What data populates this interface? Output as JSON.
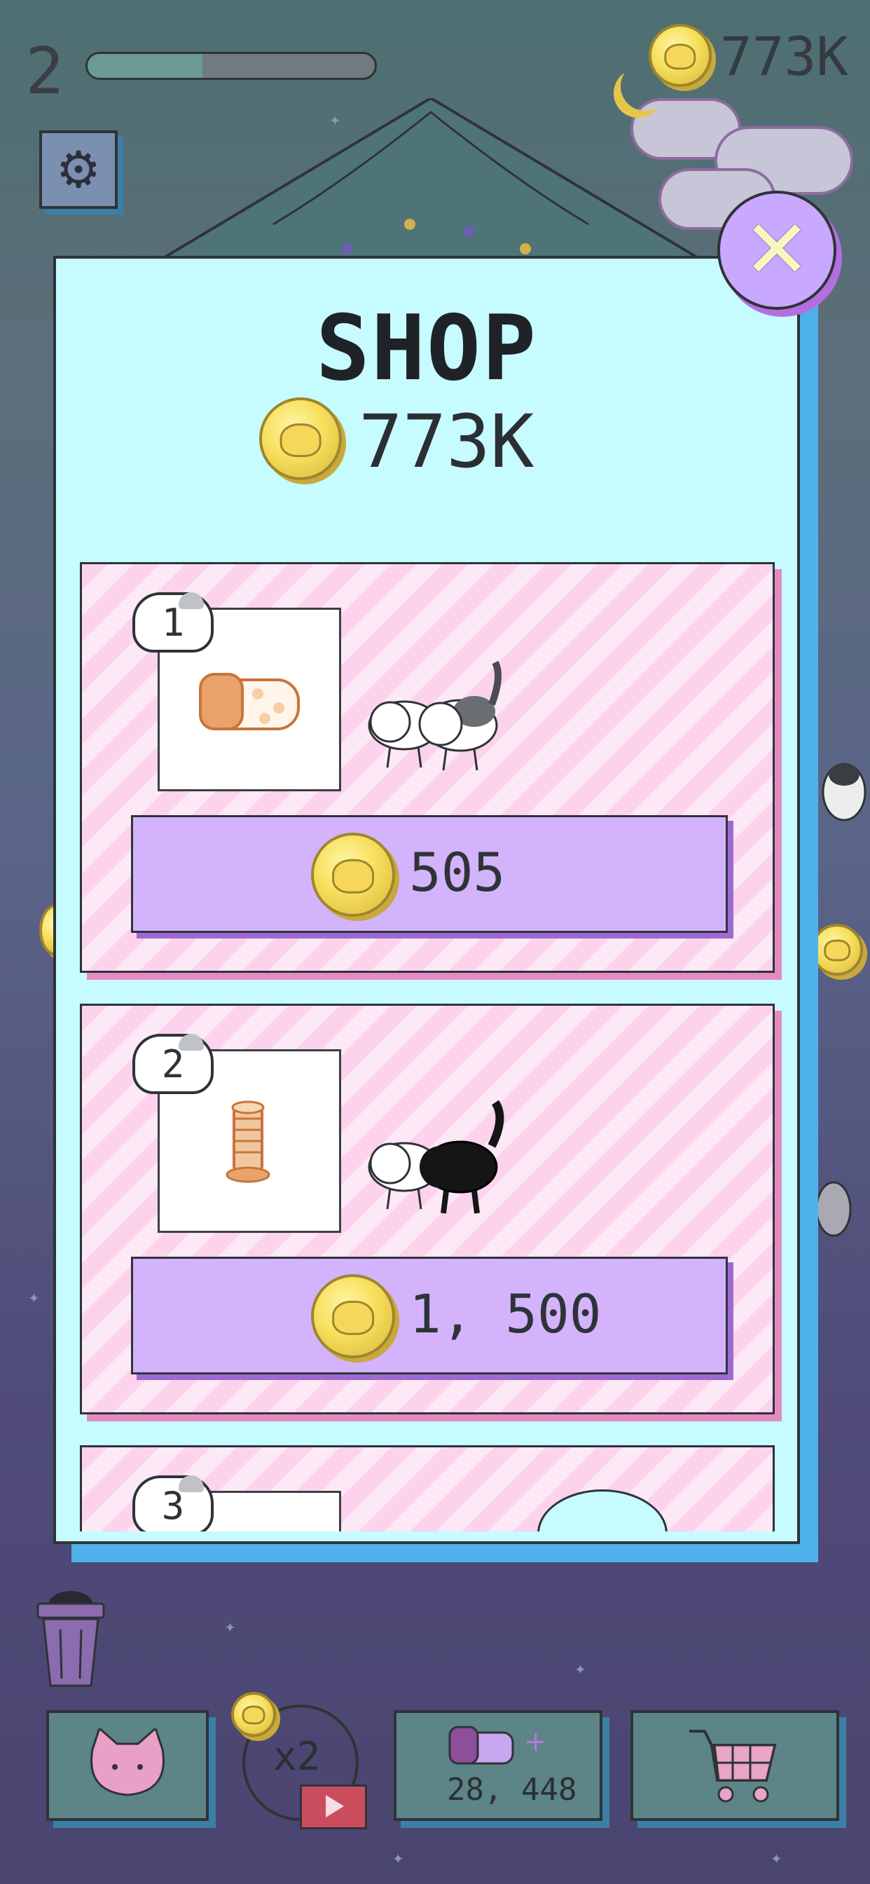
{
  "hud": {
    "level": "2",
    "level_progress": 0.4,
    "coin_total": "773K"
  },
  "shop": {
    "title": "SHOP",
    "coin_total": "773K",
    "items": [
      {
        "rank": "1",
        "price": "505",
        "item_icon": "cat-bed-icon",
        "cats": [
          "white-cat",
          "calico-cat"
        ]
      },
      {
        "rank": "2",
        "price": "1, 500",
        "item_icon": "scratching-post-icon",
        "cats": [
          "white-cat",
          "black-cat"
        ]
      },
      {
        "rank": "3",
        "price": "",
        "item_icon": "",
        "cats": []
      }
    ]
  },
  "toolbar": {
    "double_label": "x2",
    "box_count": "28, 448"
  },
  "colors": {
    "panel": "#c6fbff",
    "panel_shadow": "#4fb1e9",
    "buy_button": "#d3b3fc",
    "item_stripe": "#fdd2ec",
    "close_button": "#c9a8ff"
  }
}
